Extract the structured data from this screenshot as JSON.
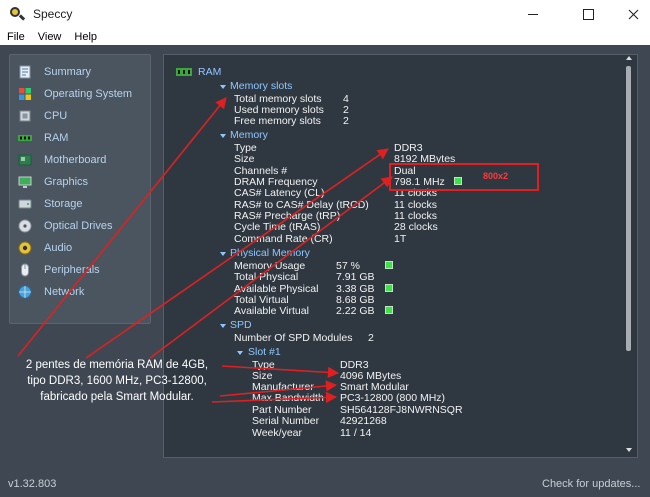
{
  "window": {
    "title": "Speccy"
  },
  "menu": [
    "File",
    "View",
    "Help"
  ],
  "sidebar": [
    {
      "label": "Summary",
      "icon": "summary-icon"
    },
    {
      "label": "Operating System",
      "icon": "windows-icon"
    },
    {
      "label": "CPU",
      "icon": "cpu-icon"
    },
    {
      "label": "RAM",
      "icon": "ram-icon"
    },
    {
      "label": "Motherboard",
      "icon": "motherboard-icon"
    },
    {
      "label": "Graphics",
      "icon": "monitor-icon"
    },
    {
      "label": "Storage",
      "icon": "disk-icon"
    },
    {
      "label": "Optical Drives",
      "icon": "optical-disc-icon"
    },
    {
      "label": "Audio",
      "icon": "speaker-icon"
    },
    {
      "label": "Peripherals",
      "icon": "mouse-icon"
    },
    {
      "label": "Network",
      "icon": "network-icon"
    }
  ],
  "content": {
    "section_title": "RAM",
    "memory_slots": {
      "heading": "Memory slots",
      "rows": [
        {
          "label": "Total memory slots",
          "value": "4"
        },
        {
          "label": "Used memory slots",
          "value": "2"
        },
        {
          "label": "Free memory slots",
          "value": "2"
        }
      ]
    },
    "memory": {
      "heading": "Memory",
      "rows": [
        {
          "label": "Type",
          "value": "DDR3"
        },
        {
          "label": "Size",
          "value": "8192 MBytes"
        },
        {
          "label": "Channels #",
          "value": "Dual"
        },
        {
          "label": "DRAM Frequency",
          "value": "798.1 MHz"
        },
        {
          "label": "CAS# Latency (CL)",
          "value": "11 clocks"
        },
        {
          "label": "RAS# to CAS# Delay (tRCD)",
          "value": "11 clocks"
        },
        {
          "label": "RAS# Precharge (tRP)",
          "value": "11 clocks"
        },
        {
          "label": "Cycle Time (tRAS)",
          "value": "28 clocks"
        },
        {
          "label": "Command Rate (CR)",
          "value": "1T"
        }
      ]
    },
    "physical_memory": {
      "heading": "Physical Memory",
      "rows": [
        {
          "label": "Memory Usage",
          "value": "57 %"
        },
        {
          "label": "Total Physical",
          "value": "7.91 GB"
        },
        {
          "label": "Available Physical",
          "value": "3.38 GB"
        },
        {
          "label": "Total Virtual",
          "value": "8.68 GB"
        },
        {
          "label": "Available Virtual",
          "value": "2.22 GB"
        }
      ]
    },
    "spd": {
      "heading": "SPD",
      "modules": {
        "label": "Number Of SPD Modules",
        "value": "2"
      },
      "slot_heading": "Slot #1",
      "rows": [
        {
          "label": "Type",
          "value": "DDR3"
        },
        {
          "label": "Size",
          "value": "4096 MBytes"
        },
        {
          "label": "Manufacturer",
          "value": "Smart Modular"
        },
        {
          "label": "Max Bandwidth",
          "value": "PC3-12800 (800 MHz)"
        },
        {
          "label": "Part Number",
          "value": "SH564128FJ8NWRNSQR"
        },
        {
          "label": "Serial Number",
          "value": "42921268"
        },
        {
          "label": "Week/year",
          "value": "11 / 14"
        }
      ]
    }
  },
  "annotation": {
    "freq_tag": "800x2",
    "callout_lines": [
      "2 pentes de memória RAM de 4GB,",
      "tipo DDR3, 1600 MHz, PC3-12800,",
      "fabricado pela Smart Modular."
    ],
    "colors": {
      "arrow": "#e02020",
      "indicator": "#3fe04a"
    }
  },
  "status": {
    "version": "v1.32.803",
    "updates": "Check for updates..."
  }
}
